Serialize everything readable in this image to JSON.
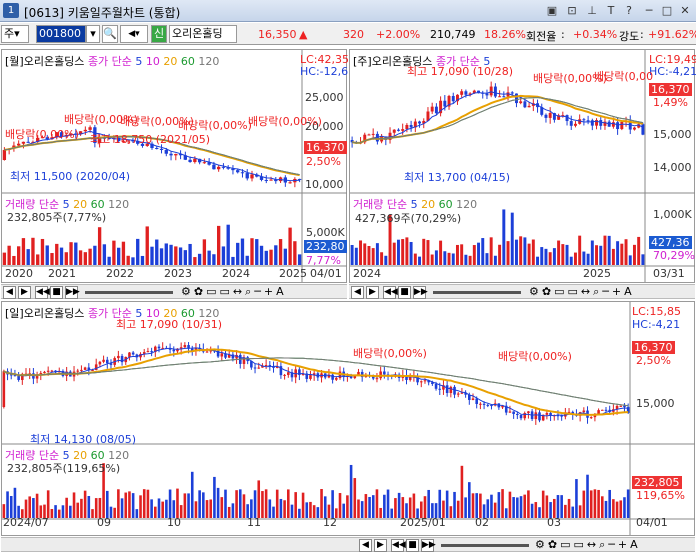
{
  "window": {
    "number": "1",
    "title": "[0613] 키움일주월차트 (통합)",
    "controls": [
      "▣",
      "⊡",
      "₹",
      "T",
      "?",
      "─",
      "□",
      "✕"
    ]
  },
  "toolbar": {
    "market": "주",
    "code": "001800",
    "sin_label": "신",
    "name": "오리온홀딩",
    "price": "16,350",
    "change": "320",
    "change_pct": "+2.00%",
    "volume": "210,749",
    "vol_ratio": "18.26%",
    "turnover_label": "회전율",
    "turnover": "+0.34%",
    "strength_label": "강도",
    "strength": "+91.62%"
  },
  "monthly": {
    "title": "[월]오리온홀딩스",
    "ma_label": "종가 단순",
    "ma_periods": [
      "5",
      "10",
      "20",
      "60",
      "120"
    ],
    "lc": "LC:42,35",
    "hc": "HC:-12,6",
    "price_tag": "16,370",
    "pct_tag": "2,50%",
    "axis": [
      "25,000",
      "20,000",
      "15,000",
      "10,000"
    ],
    "dividends": [
      "배당락(0.00%)",
      "배당락(0,00%)",
      "배당락(0,00%)",
      "배당락(0,00%)",
      "배당락(0,00%)",
      "배당락(0,00%)"
    ],
    "high": "최고 18,750 (2021/05)",
    "low": "최저 11,500 (2020/04)",
    "vol_title": "거래량",
    "vol_ma": "단순",
    "vol_value": "232,805주(7,77%)",
    "vol_axis": "5,000K",
    "vol_tag": "232,80",
    "vol_pct": "7,77%",
    "dates": [
      "2020",
      "2021",
      "2022",
      "2023",
      "2024",
      "2025",
      "04/01"
    ]
  },
  "weekly": {
    "title": "[주]오리온홀딩스",
    "ma_label": "종가 단순",
    "ma_periods": [
      "5"
    ],
    "lc": "LC:19,49",
    "hc": "HC:-4,21",
    "price_tag": "16,370",
    "pct_tag": "1,49%",
    "axis": [
      "16,000",
      "15,000",
      "14,000"
    ],
    "dividends": [
      "배당락(0,00%)",
      "배당락(0,00"
    ],
    "high": "최고 17,090 (10/28)",
    "low": "최저 13,700 (04/15)",
    "vol_title": "거래량",
    "vol_ma": "단순",
    "vol_value": "427,369주(70,29%)",
    "vol_axis": "1,000K",
    "vol_tag": "427,36",
    "vol_pct": "70,29%",
    "dates": [
      "2024",
      "2025",
      "03/31"
    ]
  },
  "daily": {
    "title": "[일]오리온홀딩스",
    "ma_label": "종가 단순",
    "ma_periods": [
      "5",
      "10",
      "20",
      "60",
      "120"
    ],
    "lc": "LC:15,85",
    "hc": "HC:-4,21",
    "price_tag": "16,370",
    "pct_tag": "2,50%",
    "axis": [
      "15,000"
    ],
    "dividends": [
      "배당락(0,00%)",
      "배당락(0,00%)"
    ],
    "high": "최고 17,090 (10/31)",
    "low": "최저 14,130 (08/05)",
    "vol_title": "거래량",
    "vol_ma": "단순",
    "vol_value": "232,805주(119,65%)",
    "vol_tag": "232,805",
    "vol_pct": "119,65%",
    "dates": [
      "2024/07",
      "09",
      "10",
      "11",
      "12",
      "2025/01",
      "02",
      "03",
      "04/01"
    ]
  },
  "colors": {
    "up": "#e02020",
    "down": "#1c3fd8",
    "ma5": "#1c3fd8",
    "ma10": "#d01fd0",
    "ma20": "#e8a000",
    "ma60": "#1c9a30",
    "ma120": "#7a7a7a"
  }
}
